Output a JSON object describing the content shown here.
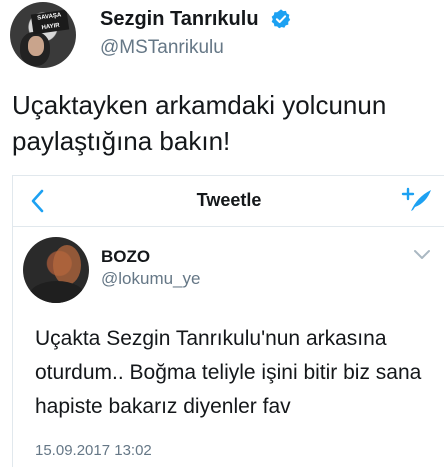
{
  "outer_tweet": {
    "author_name": "Sezgin Tanrıkulu",
    "author_handle": "@MSTanrikulu",
    "avatar_sign_text": "SAVAŞA HAYIR",
    "text": "Uçaktayken arkamdaki yolcunun paylaştığına  bakın!",
    "verified_icon": "verified-badge-icon",
    "accent_color": "#1da1f2"
  },
  "embedded_screen": {
    "nav_title": "Tweetle",
    "back_icon": "chevron-left-icon",
    "compose_icon": "compose-tweet-icon",
    "tweet": {
      "author_name": "BOZO",
      "author_handle": "@lokumu_ye",
      "text": "Uçakta Sezgin Tanrıkulu'nun arkasına oturdum.. Boğma teliyle işini bitir biz sana hapiste bakarız diyenler fav",
      "timestamp": "15.09.2017 13:02",
      "menu_icon": "chevron-down-icon"
    }
  }
}
